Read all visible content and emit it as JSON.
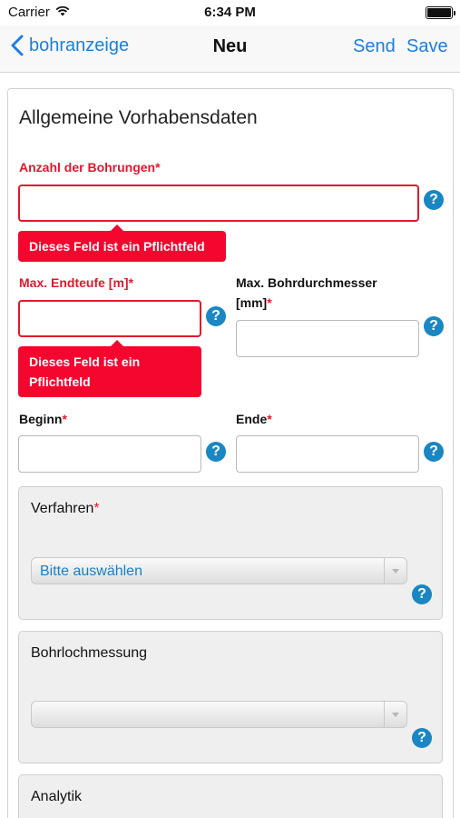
{
  "status_bar": {
    "carrier": "Carrier",
    "time": "6:34 PM"
  },
  "nav": {
    "back_label": "bohranzeige",
    "title": "Neu",
    "send_label": "Send",
    "save_label": "Save"
  },
  "form": {
    "section_title": "Allgemeine Vorhabensdaten",
    "help_glyph": "?",
    "required_marker": "*",
    "anzahl": {
      "label": "Anzahl der Bohrungen",
      "value": "",
      "error": "Dieses Feld ist ein Pflichtfeld"
    },
    "endteufe": {
      "label": "Max. Endteufe [m]",
      "value": "",
      "error_line1": "Dieses Feld ist ein",
      "error_line2": "Pflichtfeld"
    },
    "durchmesser": {
      "label_line1": "Max. Bohrdurchmesser",
      "label_line2": "[mm]",
      "value": ""
    },
    "beginn": {
      "label": "Beginn",
      "value": ""
    },
    "ende": {
      "label": "Ende",
      "value": ""
    },
    "verfahren": {
      "label": "Verfahren",
      "select_value": "Bitte auswählen"
    },
    "bohrlochmessung": {
      "label": "Bohrlochmessung",
      "select_value": ""
    },
    "analytik": {
      "label": "Analytik"
    }
  },
  "colors": {
    "accent": "#1a7fe0",
    "error": "#e0192d",
    "tooltip": "#f5062f",
    "help": "#1a86c2"
  },
  "icons": {
    "back": "chevron-left-icon",
    "wifi": "wifi-icon",
    "battery": "battery-icon",
    "help": "question-circle-icon",
    "dropdown": "chevron-down-icon"
  }
}
